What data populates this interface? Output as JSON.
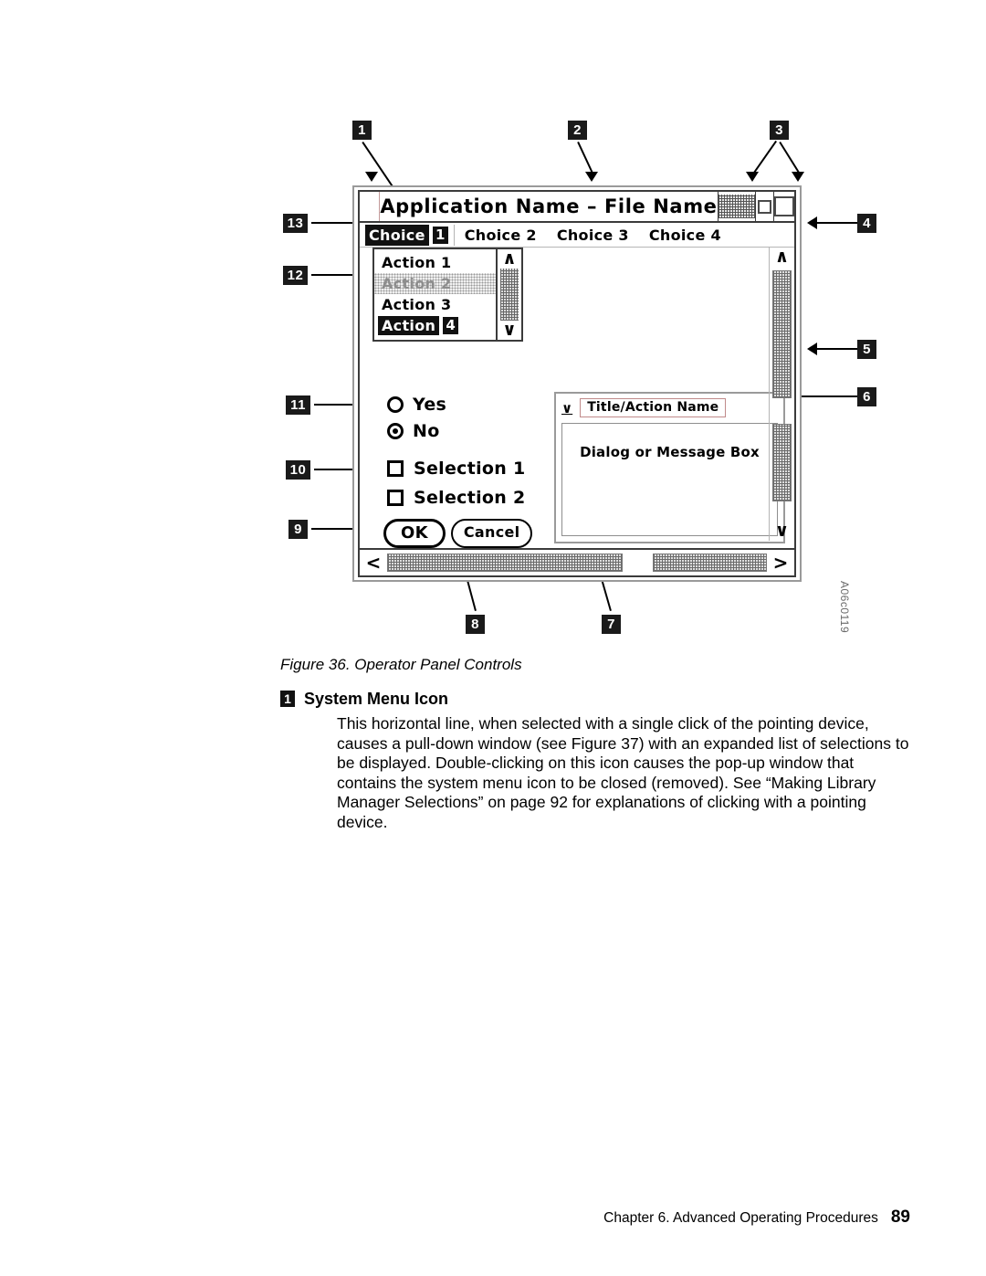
{
  "figure": {
    "id_label": "A06c0119",
    "caption": "Figure 36. Operator Panel Controls"
  },
  "mock_window": {
    "title": "Application Name – File Name",
    "system_menu_icon": "system-menu-icon",
    "title_controls": {
      "hatch": "",
      "minimize": "",
      "maximize": ""
    },
    "menubar": {
      "selected_label": "Choice",
      "selected_badge": "1",
      "items": [
        "Choice 2",
        "Choice 3",
        "Choice 4"
      ]
    },
    "pulldown": {
      "items": [
        {
          "label": "Action 1",
          "state": "normal"
        },
        {
          "label": "Action 2",
          "state": "dimmed"
        },
        {
          "label": "Action 3",
          "state": "normal"
        },
        {
          "label": "Action",
          "state": "highlight",
          "badge": "4"
        }
      ],
      "scroll_up": "∧",
      "scroll_down": "∨"
    },
    "radios": [
      {
        "label": "Yes",
        "selected": false
      },
      {
        "label": "No",
        "selected": true
      }
    ],
    "checkboxes": [
      {
        "label": "Selection 1",
        "checked": false
      },
      {
        "label": "Selection 2",
        "checked": false
      }
    ],
    "buttons": {
      "ok": "OK",
      "cancel": "Cancel"
    },
    "dialog": {
      "chevron": "∨",
      "title": "Title/Action Name",
      "body": "Dialog or Message Box"
    },
    "vscroll": {
      "up": "∧",
      "down": "∨"
    },
    "hscroll": {
      "left": "<",
      "right": ">"
    }
  },
  "callouts": [
    {
      "n": "1",
      "target": "system-menu-icon"
    },
    {
      "n": "2",
      "target": "title-bar"
    },
    {
      "n": "3",
      "target": "window-sizing-buttons"
    },
    {
      "n": "4",
      "target": "action-bar"
    },
    {
      "n": "5",
      "target": "vertical-scroll-bar"
    },
    {
      "n": "6",
      "target": "dialog-box"
    },
    {
      "n": "7",
      "target": "message-box"
    },
    {
      "n": "8",
      "target": "horizontal-scroll-bar"
    },
    {
      "n": "9",
      "target": "push-buttons"
    },
    {
      "n": "10",
      "target": "check-boxes"
    },
    {
      "n": "11",
      "target": "radio-buttons"
    },
    {
      "n": "12",
      "target": "unavailable-action"
    },
    {
      "n": "13",
      "target": "pull-down-choice"
    }
  ],
  "term": {
    "badge": "1",
    "title": "System Menu Icon",
    "body": "This horizontal line, when selected with a single click of the pointing device, causes a pull-down window (see Figure 37) with an expanded list of selections to be displayed. Double-clicking on this icon causes the pop-up window that contains the system menu icon to be closed (removed). See “Making Library Manager Selections” on page 92 for explanations of clicking with a pointing device."
  },
  "footer": {
    "chapter": "Chapter 6. Advanced Operating Procedures",
    "page": "89"
  }
}
